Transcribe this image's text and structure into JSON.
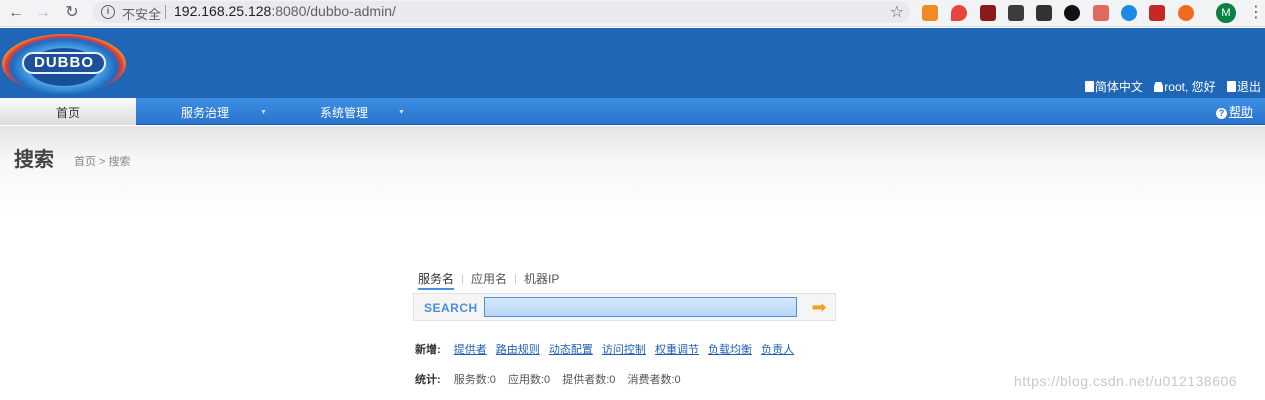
{
  "browser": {
    "insecure_label": "不安全",
    "url_host": "192.168.25.128",
    "url_rest": ":8080/dubbo-admin/",
    "avatar_letter": "M"
  },
  "header": {
    "logo_text": "DUBBO",
    "language": "简体中文",
    "greeting": "root, 您好",
    "logout": "退出"
  },
  "menu": {
    "items": [
      {
        "label": "首页"
      },
      {
        "label": "服务治理"
      },
      {
        "label": "系统管理"
      }
    ],
    "help": "帮助"
  },
  "page": {
    "title": "搜索",
    "breadcrumb": "首页 > 搜索"
  },
  "search": {
    "tabs": [
      "服务名",
      "应用名",
      "机器IP"
    ],
    "label": "SEARCH",
    "value": ""
  },
  "create": {
    "label": "新增:",
    "links": [
      "提供者",
      "路由规则",
      "动态配置",
      "访问控制",
      "权重调节",
      "负载均衡",
      "负责人"
    ]
  },
  "stats": {
    "label": "统计:",
    "items": [
      "服务数:0",
      "应用数:0",
      "提供者数:0",
      "消费者数:0"
    ]
  },
  "watermark": "https://blog.csdn.net/u012138606",
  "colors": {
    "header_blue": "#2066b6",
    "menu_blue": "#2a73cc",
    "link_blue": "#1f5fb5",
    "accent": "#4a8ee0"
  }
}
